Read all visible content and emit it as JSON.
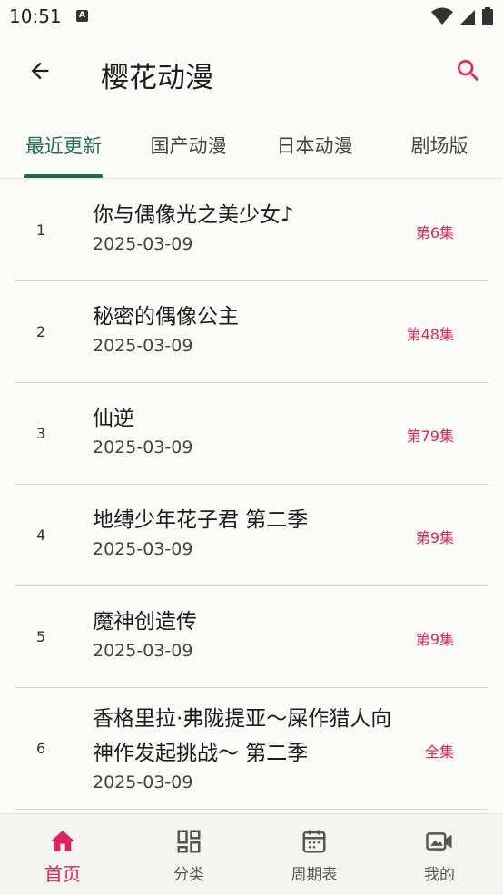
{
  "status_bar": {
    "time": "10:51",
    "icons": [
      "text-a-icon",
      "wifi-icon",
      "signal-icon",
      "battery-icon"
    ]
  },
  "app_bar": {
    "title": "樱花动漫",
    "icons": [
      "arrow-back-icon",
      "search-icon"
    ],
    "accent_color": "#e0245e"
  },
  "tabs": [
    {
      "label": "最近更新",
      "active": true
    },
    {
      "label": "国产动漫",
      "active": false
    },
    {
      "label": "日本动漫",
      "active": false
    },
    {
      "label": "剧场版",
      "active": false
    }
  ],
  "active_tab_color": "#1f6b50",
  "list": [
    {
      "index": "1",
      "title": "你与偶像光之美少女♪",
      "date": "2025-03-09",
      "episode": "第6集"
    },
    {
      "index": "2",
      "title": "秘密的偶像公主",
      "date": "2025-03-09",
      "episode": "第48集"
    },
    {
      "index": "3",
      "title": "仙逆",
      "date": "2025-03-09",
      "episode": "第79集"
    },
    {
      "index": "4",
      "title": "地缚少年花子君 第二季",
      "date": "2025-03-09",
      "episode": "第9集"
    },
    {
      "index": "5",
      "title": "魔神创造传",
      "date": "2025-03-09",
      "episode": "第9集"
    },
    {
      "index": "6",
      "title": "香格里拉·弗陇提亚～屎作猎人向神作发起挑战～ 第二季",
      "date": "2025-03-09",
      "episode": "全集"
    }
  ],
  "bottom_nav": [
    {
      "label": "首页",
      "icon": "home-icon",
      "active": true
    },
    {
      "label": "分类",
      "icon": "category-icon",
      "active": false
    },
    {
      "label": "周期表",
      "icon": "calendar-icon",
      "active": false
    },
    {
      "label": "我的",
      "icon": "video-icon",
      "active": false
    }
  ]
}
